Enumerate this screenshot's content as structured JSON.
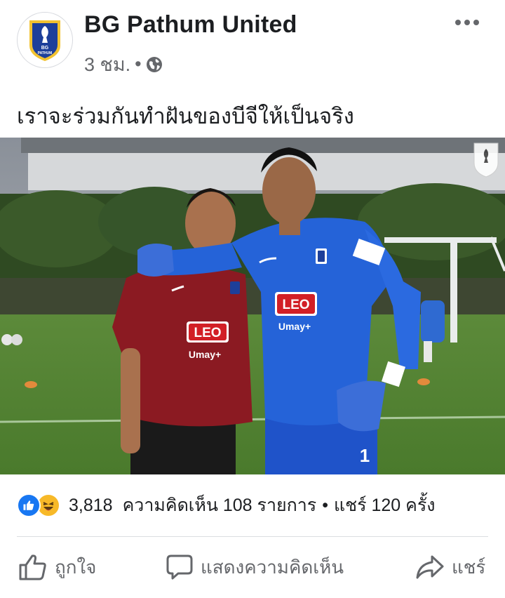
{
  "post": {
    "page_name": "BG Pathum United",
    "time": "3 ชม.",
    "separator": "•",
    "audience_icon": "globe-icon",
    "text": "เราจะร่วมกันทำฝันของบีจีให้เป็นจริง"
  },
  "avatar": {
    "line1": "BG",
    "line2": "PATHUM"
  },
  "photo": {
    "jersey_sponsor": "LEO",
    "jersey_secondary": "Umay+",
    "keeper_number": "1"
  },
  "stats": {
    "reaction_count": "3,818",
    "comments": "ความคิดเห็น 108 รายการ",
    "separator": "•",
    "shares": "แชร์ 120 ครั้ง"
  },
  "actions": {
    "like_label": "ถูกใจ",
    "comment_label": "แสดงความคิดเห็น",
    "share_label": "แชร์"
  },
  "colors": {
    "brand_blue": "#1877f2",
    "text_secondary": "#65676b",
    "haha_yellow": "#f7b928"
  }
}
